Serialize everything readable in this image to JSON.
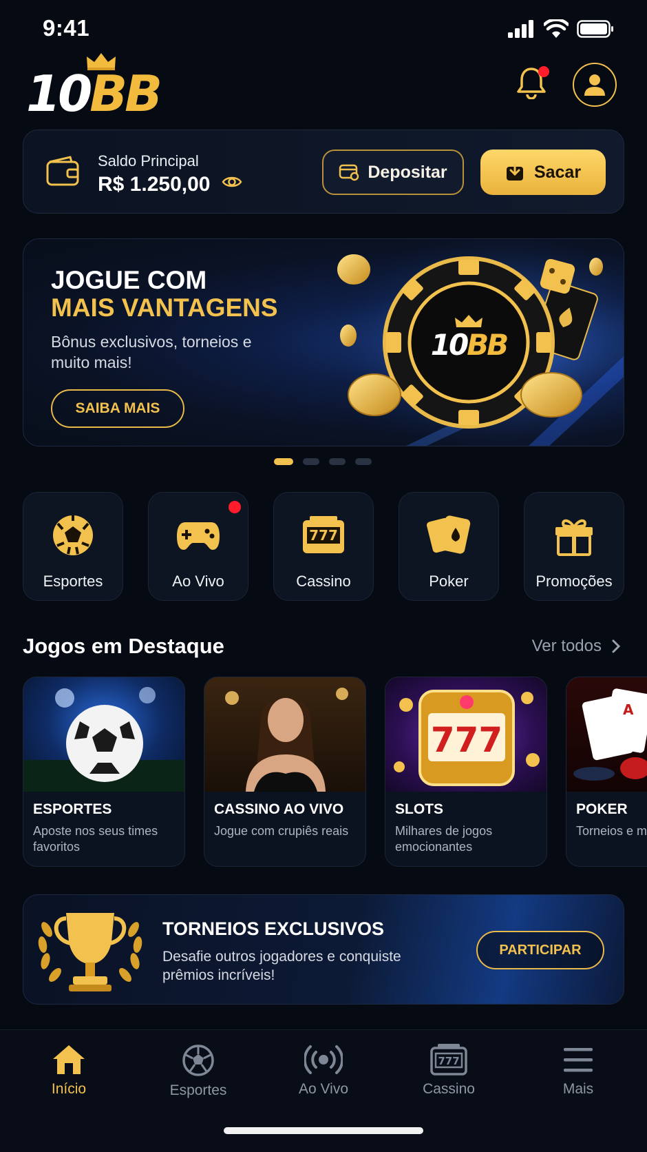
{
  "status_bar": {
    "time": "9:41"
  },
  "header": {
    "logo_text_white": "10",
    "logo_text_gold": "BB"
  },
  "balance": {
    "label": "Saldo Principal",
    "amount": "R$ 1.250,00",
    "deposit_label": "Depositar",
    "withdraw_label": "Sacar"
  },
  "hero": {
    "title_line1": "JOGUE COM",
    "title_line2": "MAIS VANTAGENS",
    "subtitle": "Bônus exclusivos, torneios e muito mais!",
    "cta_label": "SAIBA MAIS",
    "chip_logo_white": "10",
    "chip_logo_gold": "BB",
    "carousel_active_index": 0,
    "carousel_count": 4
  },
  "categories": [
    {
      "label": "Esportes",
      "icon": "soccer-ball-icon"
    },
    {
      "label": "Ao Vivo",
      "icon": "gamepad-icon",
      "has_badge": true
    },
    {
      "label": "Cassino",
      "icon": "slot-777-icon"
    },
    {
      "label": "Poker",
      "icon": "playing-cards-icon"
    },
    {
      "label": "Promoções",
      "icon": "gift-icon"
    }
  ],
  "featured": {
    "title": "Jogos em Destaque",
    "see_all": "Ver todos",
    "games": [
      {
        "title": "ESPORTES",
        "desc": "Aposte nos seus times favoritos"
      },
      {
        "title": "CASSINO AO VIVO",
        "desc": "Jogue com crupiês reais"
      },
      {
        "title": "SLOTS",
        "desc": "Milhares de jogos emocionantes"
      },
      {
        "title": "POKER",
        "desc": "Torneios e mesas"
      }
    ]
  },
  "tournaments": {
    "title": "TORNEIOS EXCLUSIVOS",
    "desc": "Desafie outros jogadores e conquiste prêmios incríveis!",
    "button": "PARTICIPAR"
  },
  "nav": {
    "items": [
      {
        "label": "Início",
        "icon": "home-icon",
        "active": true
      },
      {
        "label": "Esportes",
        "icon": "soccer-ball-icon"
      },
      {
        "label": "Ao Vivo",
        "icon": "live-broadcast-icon"
      },
      {
        "label": "Cassino",
        "icon": "slot-777-icon"
      },
      {
        "label": "Mais",
        "icon": "menu-icon"
      }
    ]
  },
  "colors": {
    "accent": "#f2c14e",
    "background": "#060a12",
    "badge": "#ff1c2b"
  }
}
